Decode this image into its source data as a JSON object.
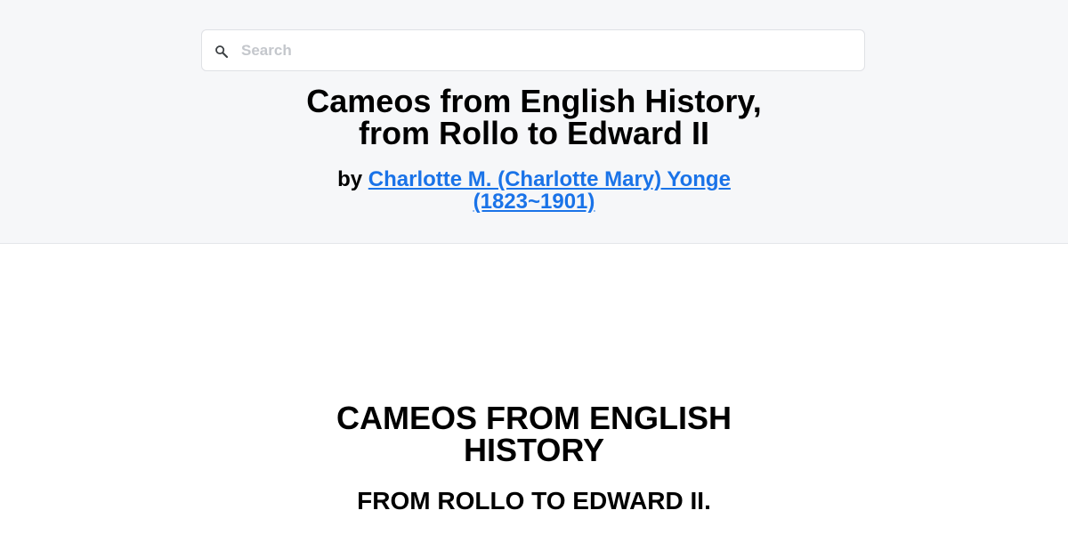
{
  "search": {
    "placeholder": "Search",
    "value": "",
    "icon": "search-icon"
  },
  "book": {
    "title_line1": "Cameos from English History,",
    "title_line2": "from Rollo to Edward II",
    "by_label": "by",
    "author_line1": "Charlotte M. (Charlotte Mary) Yonge",
    "author_line2": "(1823~1901)"
  },
  "content": {
    "title_line1": "CAMEOS FROM ENGLISH",
    "title_line2": "HISTORY",
    "subtitle": "FROM ROLLO TO EDWARD II."
  },
  "colors": {
    "header_background": "#f6f7f9",
    "link": "#1a73e8",
    "text": "#000000"
  }
}
